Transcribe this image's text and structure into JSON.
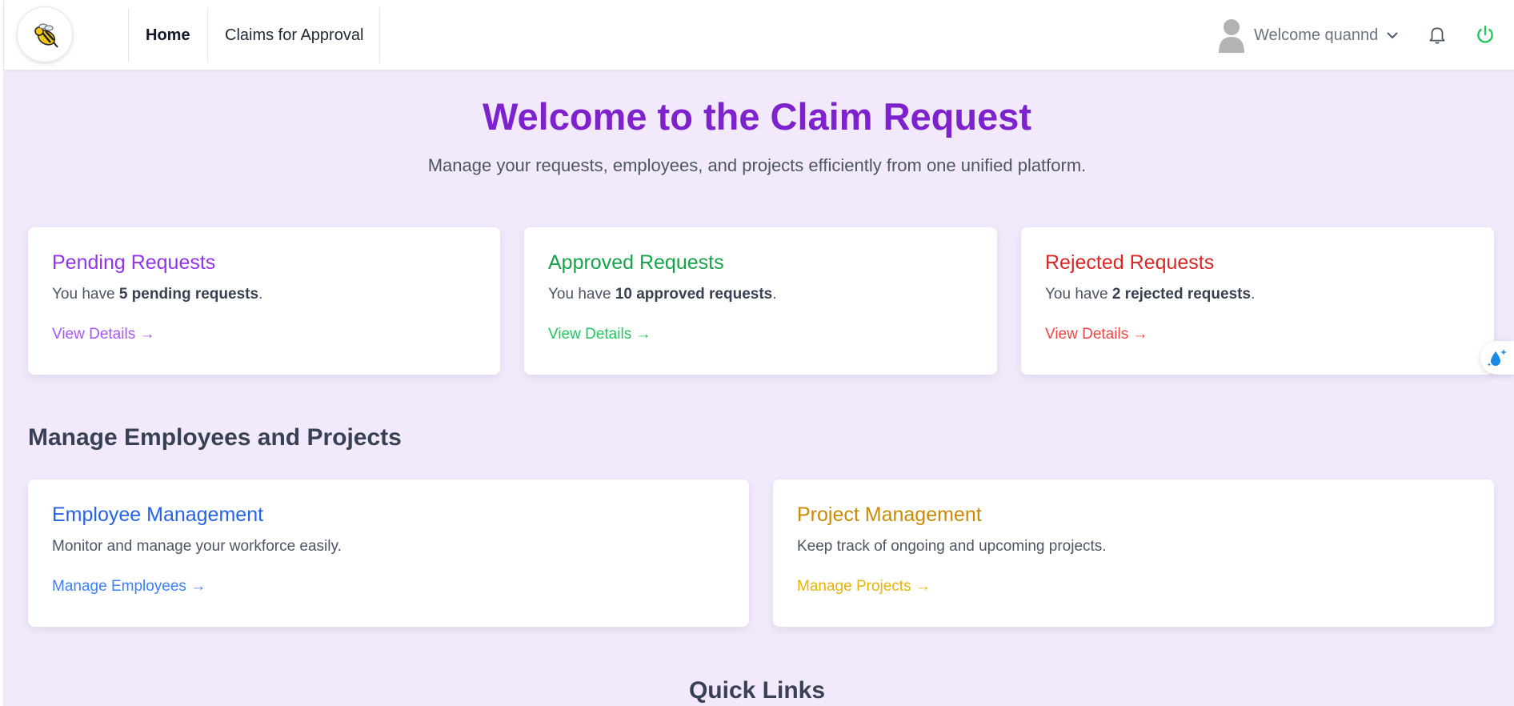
{
  "header": {
    "nav": [
      {
        "label": "Home",
        "active": true
      },
      {
        "label": "Claims for Approval",
        "active": false
      }
    ],
    "user_label": "Welcome quannd",
    "icons": [
      "bee-logo",
      "user-avatar-icon",
      "chevron-down-icon",
      "bell-icon",
      "power-icon"
    ]
  },
  "hero": {
    "title": "Welcome to the Claim Request",
    "subtitle": "Manage your requests, employees, and projects efficiently from one unified platform."
  },
  "status_cards": [
    {
      "title": "Pending Requests",
      "prefix": "You have ",
      "highlight": "5 pending requests",
      "suffix": ".",
      "link": "View Details →",
      "title_color": "#9333ea",
      "link_color": "#a855f7"
    },
    {
      "title": "Approved Requests",
      "prefix": "You have ",
      "highlight": "10 approved requests",
      "suffix": ".",
      "link": "View Details →",
      "title_color": "#16a34a",
      "link_color": "#22c55e"
    },
    {
      "title": "Rejected Requests",
      "prefix": "You have ",
      "highlight": "2 rejected requests",
      "suffix": ".",
      "link": "View Details →",
      "title_color": "#dc2626",
      "link_color": "#ef4444"
    }
  ],
  "manage": {
    "section_title": "Manage Employees and Projects",
    "cards": [
      {
        "title": "Employee Management",
        "desc": "Monitor and manage your workforce easily.",
        "link": "Manage Employees →",
        "title_color": "#2563eb",
        "link_color": "#3b82f6"
      },
      {
        "title": "Project Management",
        "desc": "Keep track of ongoing and upcoming projects.",
        "link": "Manage Projects →",
        "title_color": "#ca8a04",
        "link_color": "#eab308"
      }
    ]
  },
  "quick_links": {
    "title": "Quick Links"
  }
}
